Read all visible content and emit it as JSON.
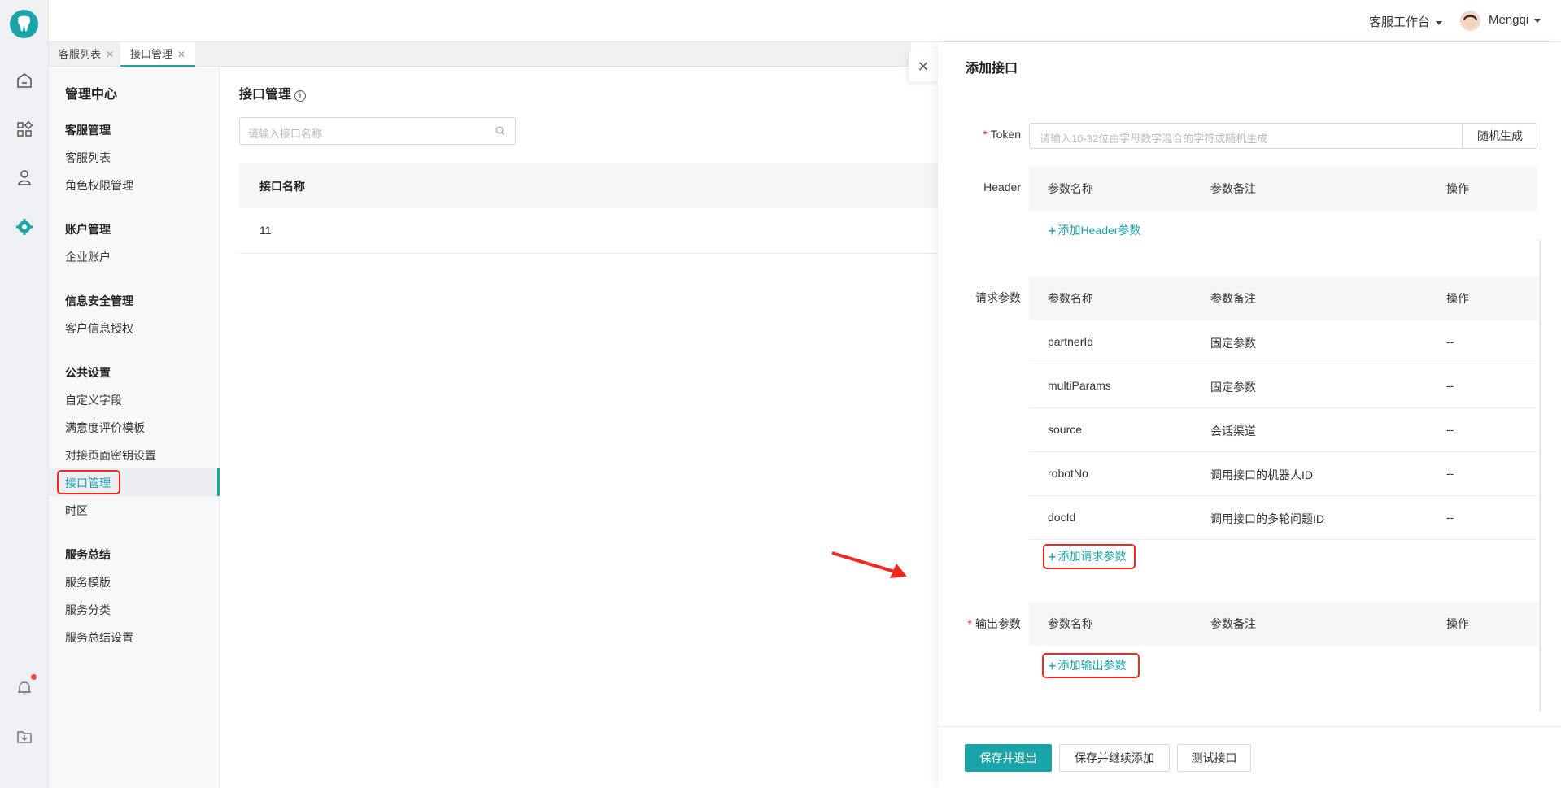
{
  "colors": {
    "accent": "#1aa3a8",
    "highlight": "#f0281e"
  },
  "topbar": {
    "workspace": "客服工作台",
    "user": "Mengqi"
  },
  "tabs": [
    {
      "label": "客服列表"
    },
    {
      "label": "接口管理"
    }
  ],
  "sidebar": {
    "title": "管理中心",
    "groups": [
      {
        "label": "客服管理",
        "items": [
          "客服列表",
          "角色权限管理"
        ]
      },
      {
        "label": "账户管理",
        "items": [
          "企业账户"
        ]
      },
      {
        "label": "信息安全管理",
        "items": [
          "客户信息授权"
        ]
      },
      {
        "label": "公共设置",
        "items": [
          "自定义字段",
          "满意度评价模板",
          "对接页面密钥设置",
          "接口管理",
          "时区"
        ]
      },
      {
        "label": "服务总结",
        "items": [
          "服务模版",
          "服务分类",
          "服务总结设置"
        ]
      }
    ]
  },
  "main": {
    "title": "接口管理",
    "search_placeholder": "请输入接口名称",
    "column": "接口名称",
    "rows": [
      "11"
    ]
  },
  "drawer": {
    "title": "添加接口",
    "token_label": "Token",
    "token_placeholder": "请输入10-32位由字母数字混合的字符或随机生成",
    "random_button": "随机生成",
    "header_label": "Header",
    "request_label": "请求参数",
    "output_label": "输出参数",
    "col_name": "参数名称",
    "col_note": "参数备注",
    "col_op": "操作",
    "add_header": "添加Header参数",
    "add_request": "添加请求参数",
    "add_output": "添加输出参数",
    "request_params": [
      {
        "name": "partnerId",
        "note": "固定参数",
        "op": "--"
      },
      {
        "name": "multiParams",
        "note": "固定参数",
        "op": "--"
      },
      {
        "name": "source",
        "note": "会话渠道",
        "op": "--"
      },
      {
        "name": "robotNo",
        "note": "调用接口的机器人ID",
        "op": "--"
      },
      {
        "name": "docId",
        "note": "调用接口的多轮问题ID",
        "op": "--"
      }
    ],
    "buttons": {
      "save_exit": "保存并退出",
      "save_continue": "保存并继续添加",
      "test": "测试接口"
    }
  }
}
